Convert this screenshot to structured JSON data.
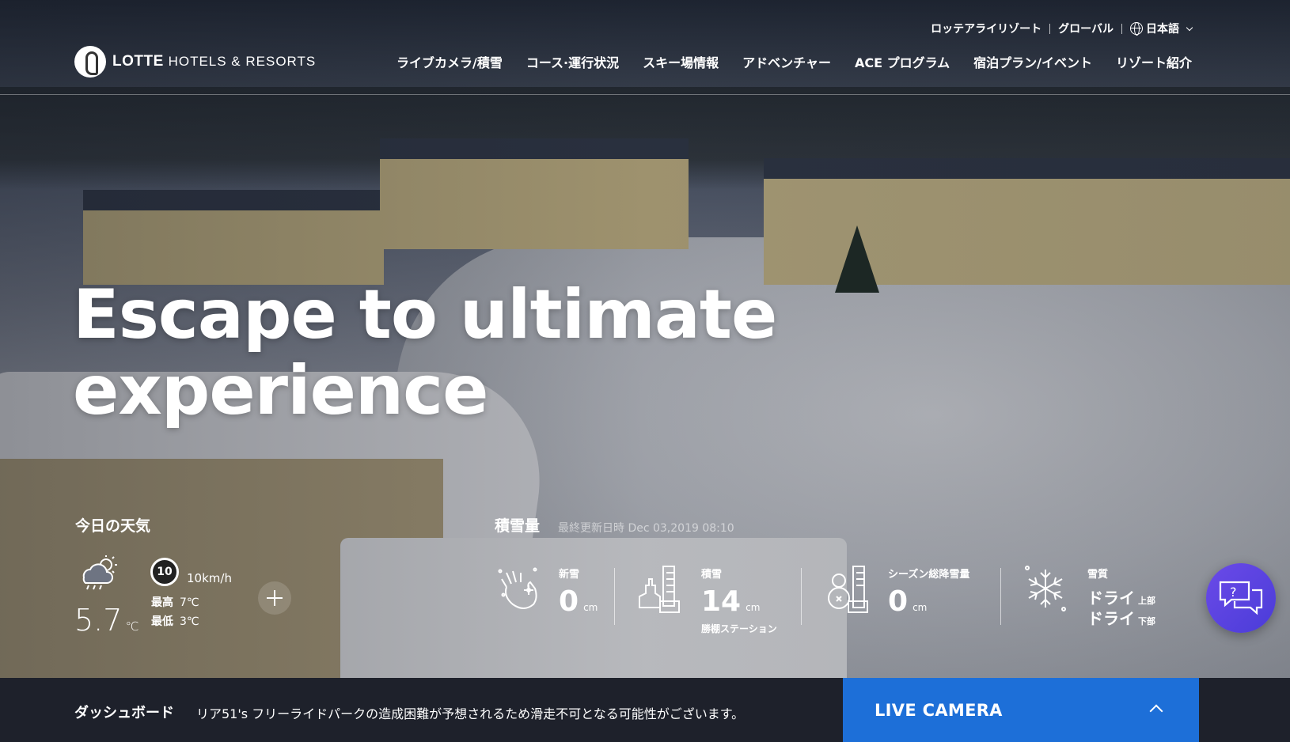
{
  "header": {
    "util_nav": [
      "ロッテアライリゾート",
      "グローバル"
    ],
    "language": "日本語",
    "logo_brand": "LOTTE",
    "logo_sub": "HOTELS & RESORTS",
    "main_nav": [
      "ライブカメラ/積雪",
      "コース·運行状況",
      "スキー場情報",
      "アドベンチャー",
      "ACE プログラム",
      "宿泊プラン/イベント",
      "リゾート紹介"
    ]
  },
  "hero": {
    "line1": "Escape to ultimate",
    "line2": "experience"
  },
  "weather": {
    "title": "今日の天気",
    "temperature": "5.7",
    "temp_unit": "℃",
    "wind_level": "10",
    "wind_speed": "10km/h",
    "max_label": "最高",
    "max_value": "7℃",
    "min_label": "最低",
    "min_value": "3℃"
  },
  "snow": {
    "title": "積雪量",
    "updated": "最終更新日時 Dec 03,2019 08:10",
    "new_snow_label": "新雪",
    "new_snow_value": "0",
    "new_snow_unit": "cm",
    "depth_label": "積雪",
    "depth_value": "14",
    "depth_unit": "cm",
    "depth_station": "勝棚ステーション",
    "season_label": "シーズン総降雪量",
    "season_value": "0",
    "season_unit": "cm",
    "quality_label": "雪質",
    "quality_top": "ドライ",
    "quality_top_unit": "上部",
    "quality_bottom": "ドライ",
    "quality_bottom_unit": "下部"
  },
  "bottom_bar": {
    "dashboard_label": "ダッシュボード",
    "message": "リア51's フリーライドパークの造成困難が予想されるため滑走不可となる可能性がございます。",
    "live_camera": "LIVE CAMERA"
  },
  "colors": {
    "live_camera_bg": "#1d6fd8",
    "bottom_bar_bg": "#1e212b",
    "chat_bg": "#5a42e0"
  },
  "icons": [
    "globe-icon",
    "chevron-down-icon",
    "cloud-sun-rain-icon",
    "wind-badge-icon",
    "plus-icon",
    "hand-snow-icon",
    "snow-gauge-icon",
    "snowman-gauge-icon",
    "snowflake-icon",
    "chat-help-icon",
    "chevron-up-icon"
  ]
}
